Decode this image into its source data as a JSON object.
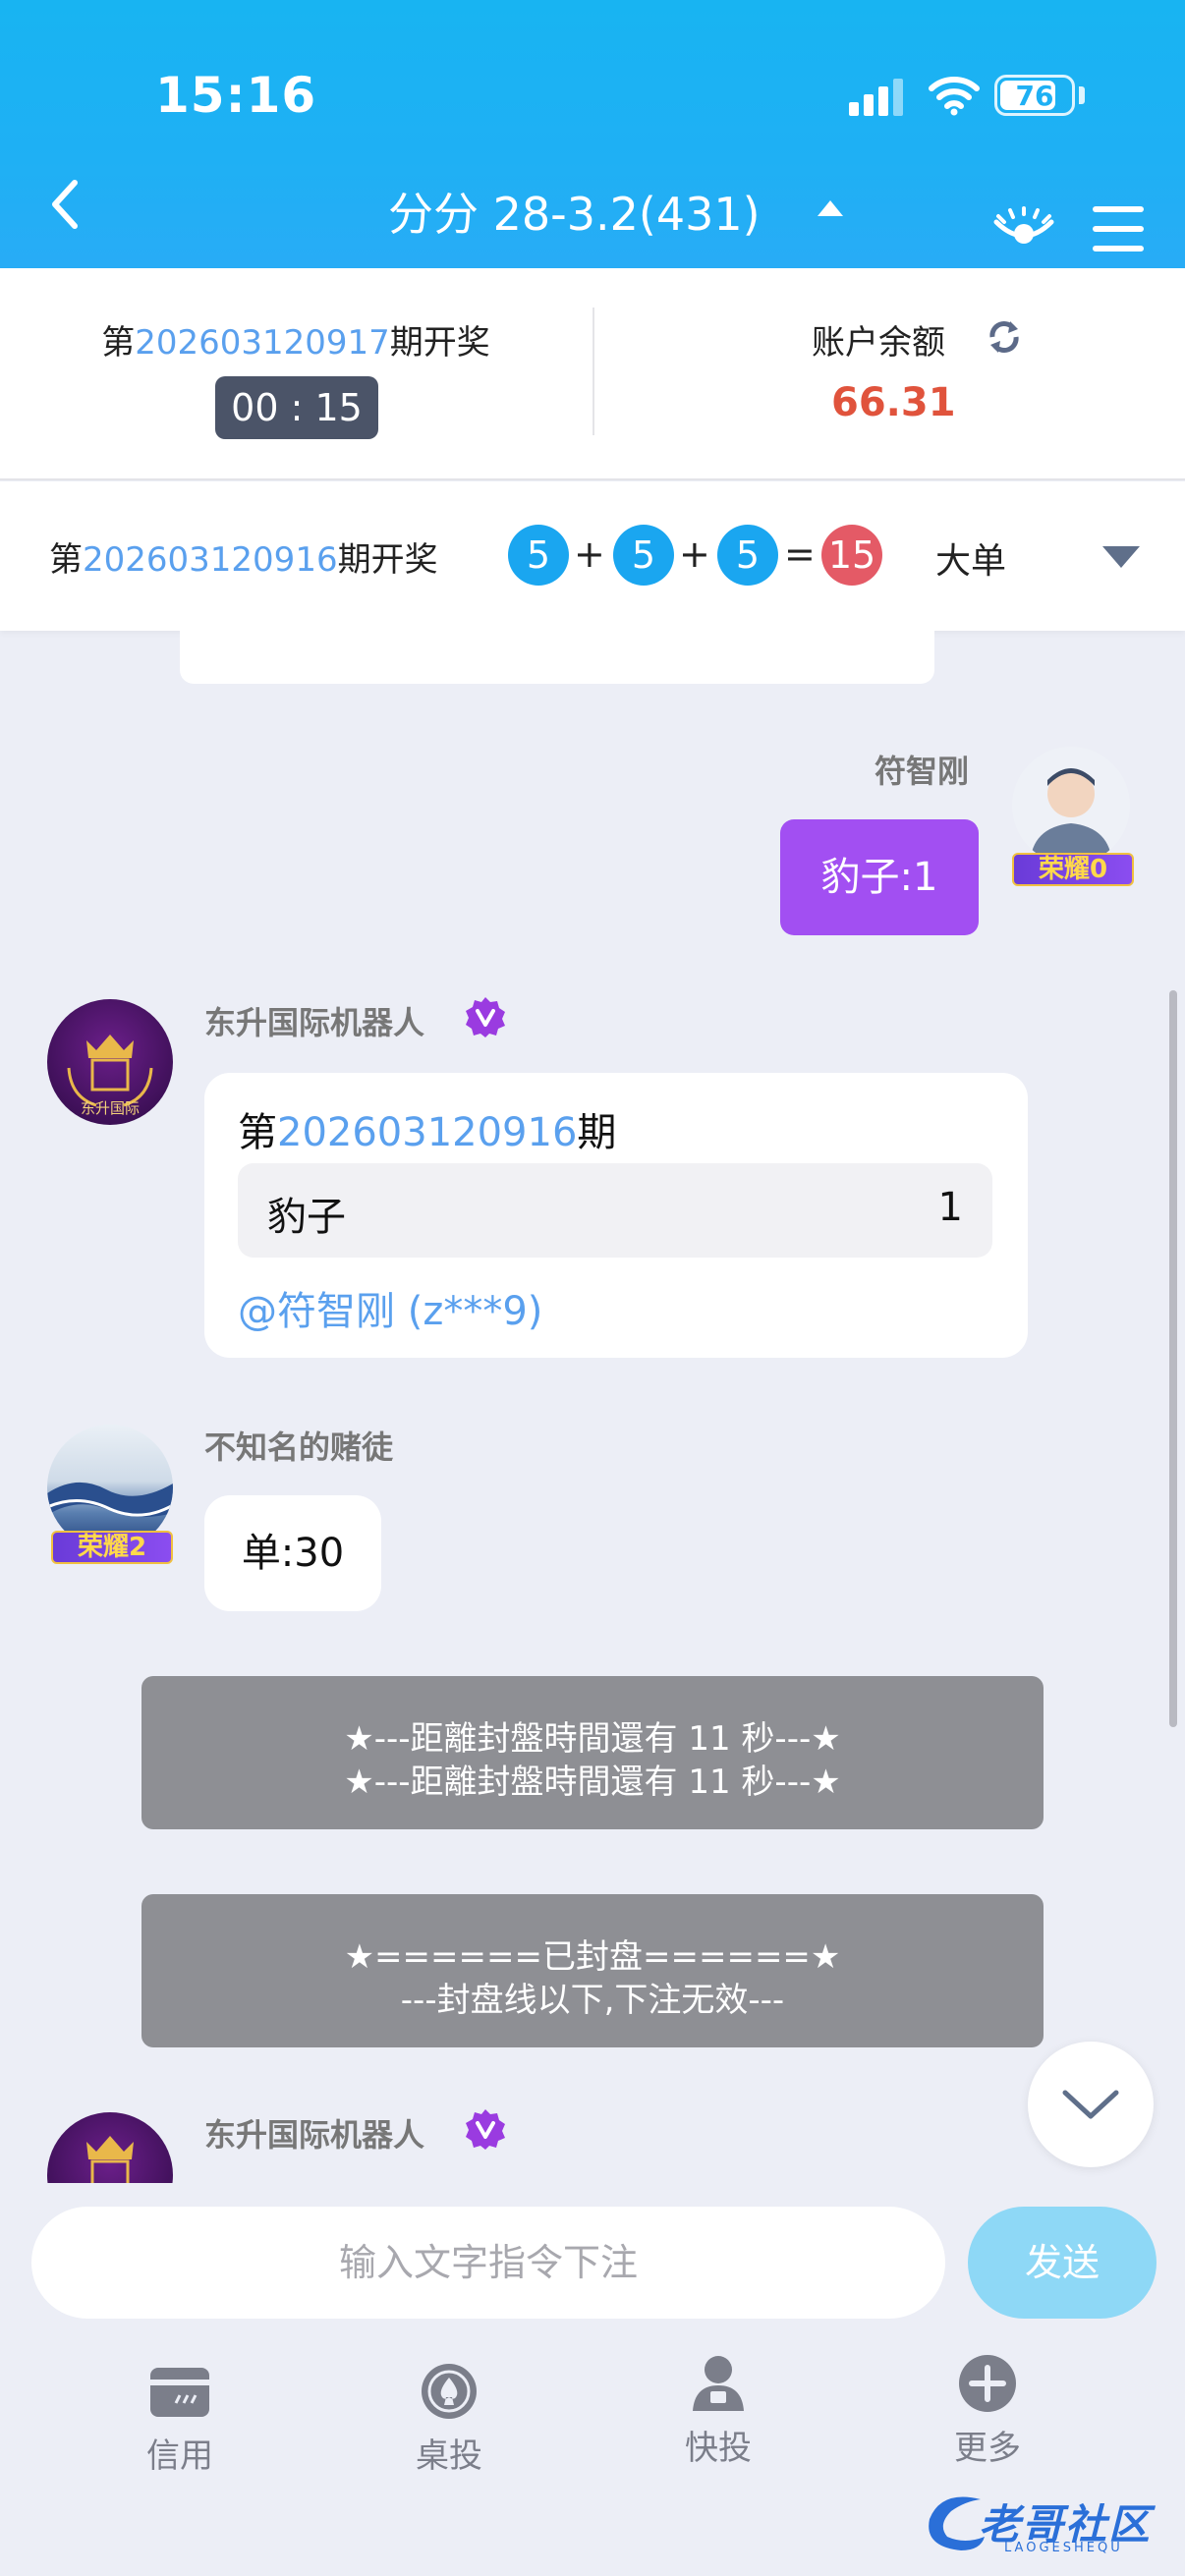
{
  "status_bar": {
    "time": "15:16",
    "battery": "76"
  },
  "nav": {
    "title": "分分 28-3.2(431)"
  },
  "info": {
    "next_prefix": "第",
    "next_period": "202603120917",
    "next_suffix": "期开奖",
    "countdown": "00 : 15",
    "balance_label": "账户余额",
    "balance_value": "66.31"
  },
  "last_result": {
    "prefix": "第",
    "period": "202603120916",
    "suffix": "期开奖",
    "balls": [
      "5",
      "5",
      "5"
    ],
    "plus": "+",
    "equals": "=",
    "sum": "15",
    "result_type": "大单"
  },
  "messages": {
    "m1": {
      "sender": "符智刚",
      "text": "豹子:1",
      "rank": "荣耀0"
    },
    "m2": {
      "sender": "东升国际机器人",
      "avatar_text": "东升国际",
      "period_prefix": "第",
      "period": "202603120916",
      "period_suffix": "期",
      "bet_name": "豹子",
      "bet_amount": "1",
      "mention": "@符智刚 (z***9)"
    },
    "m3": {
      "sender": "不知名的赌徒",
      "text": "单:30",
      "rank": "荣耀2"
    },
    "sys1": {
      "line1": "★---距離封盤時間還有 11 秒---★",
      "line2": "★---距離封盤時間還有 11 秒---★"
    },
    "sys2": {
      "line1": "★======已封盘======★",
      "line2": "---封盘线以下,下注无效---"
    },
    "m4": {
      "sender": "东升国际机器人"
    }
  },
  "input": {
    "placeholder": "输入文字指令下注",
    "send_label": "发送"
  },
  "tabs": [
    {
      "label": "信用",
      "icon": "credit-card-icon"
    },
    {
      "label": "桌投",
      "icon": "spade-chip-icon"
    },
    {
      "label": "快投",
      "icon": "user-lock-icon"
    },
    {
      "label": "更多",
      "icon": "plus-circle-icon"
    }
  ],
  "watermark": {
    "text": "老哥社区",
    "sub": "LAOGESHEQU"
  },
  "colors": {
    "header": "#1fb0f4",
    "accent_blue": "#5aa0ee",
    "ball_blue": "#1aa6f0",
    "ball_red": "#e45a66",
    "balance": "#e0533c",
    "user_bubble": "#a24ff2"
  }
}
